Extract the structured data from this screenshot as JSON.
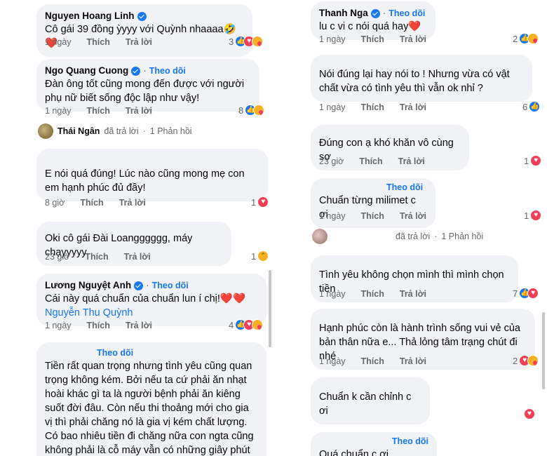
{
  "labels": {
    "like": "Thích",
    "reply": "Trả lời",
    "follow": "Theo dõi",
    "replied": "đã trả lời",
    "dot": "·"
  },
  "left": {
    "c1": {
      "author": "Nguyen Hoang Linh",
      "text": "Cô gái 39 đồng ỳyyy với Quỳnh nhaaaa🤣❤️",
      "time": "1 ngày",
      "count": "3"
    },
    "c2": {
      "author": "Ngo Quang Cuong",
      "text": "Đàn ông tốt cũng mong đến được với người phụ nữ biết sống độc lập như vậy!",
      "time": "1 ngày",
      "count": "8"
    },
    "reply_summary": {
      "author": "Thái Ngân",
      "count": "1 Phản hồi"
    },
    "c3": {
      "text": "E nói quá đúng! Lúc nào cũng mong mẹ con em hạnh phúc đủ đầy!",
      "time": "8 giờ",
      "count": "1"
    },
    "c4": {
      "text": "Oki cô gái Đài Loangggggg, máy chạyyyyy",
      "time": "23 giờ",
      "count": "1"
    },
    "c5": {
      "author": "Lương Nguyệt Anh",
      "text": "Cái này quá chuẩn của chuẩn lun í chị!❤️❤️",
      "mention": "Nguyễn Thu Quỳnh",
      "time": "1 ngày",
      "count": "4"
    },
    "c6": {
      "text": "Tiền rất quan trọng nhưng tình yêu cũng quan trọng không kém. Bởi nếu ta cứ phải ăn nhạt hoài khác gì ta là người bệnh phải ăn kiêng suốt đời đâu. Còn nếu thi thoảng mới cho gia vị thì phải chăng nó là gia vị kém chất lượng. Có bao nhiêu tiền đi chăng nữa con ngta cũng không phải là cỗ máy vẫn có những giây phút cảm thấy mình cô đơn."
    }
  },
  "right": {
    "c1": {
      "author": "Thanh Nga",
      "text": "lu c vi c nói quá hay❤️",
      "time": "1 ngày",
      "count": "2"
    },
    "c2": {
      "text": "Nói đúng lại hay nói to ! Nhưng vừa có vật chất vừa có tình yêu thì vẫn ok nhỉ ?",
      "time": "1 ngày",
      "count": "6"
    },
    "c3": {
      "text": "Đúng con ạ khó khăn vô cùng sợ",
      "time": "23 giờ",
      "count": "1"
    },
    "c4": {
      "text": "Chuẩn từng milimet c ơi",
      "time": "1 ngày",
      "count": "1"
    },
    "reply_summary": {
      "count": "1 Phản hồi"
    },
    "c5": {
      "text": "Tình yêu không chọn mình thì mình chọn tiền",
      "time": "1 ngày",
      "count": "7"
    },
    "c6": {
      "text": "Hạnh phúc còn là hành trình sống vui vẻ của bản thân nữa e... Thả lỏng tâm trạng chút đi nhé",
      "time": "1 ngày",
      "count": "2"
    },
    "c7": {
      "text": "Chuẩn k cần chỉnh c ơi"
    },
    "c8": {
      "text": "Quá chuẩn c ơi"
    }
  }
}
